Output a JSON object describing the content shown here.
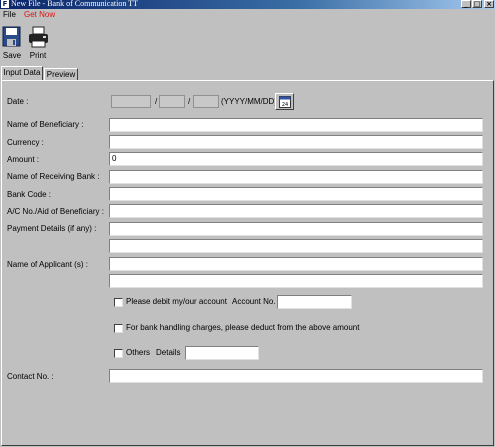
{
  "window": {
    "title": "New File - Bank of Communication TT"
  },
  "menu": {
    "file": "File",
    "get_now": "Get Now"
  },
  "toolbar": {
    "save_label": "Save",
    "print_label": "Print"
  },
  "tabs": [
    "Input Data",
    "Preview"
  ],
  "form": {
    "date_label": "Date :",
    "date_sep": "/",
    "date_format": "(YYYY/MM/DD)",
    "beneficiary_label": "Name of Beneficiary :",
    "currency_label": "Currency :",
    "amount_label": "Amount :",
    "amount_value": "0",
    "receiving_bank_label": "Name of Receiving Bank :",
    "bank_code_label": "Bank Code :",
    "account_label": "A/C No./Aid of Beneficiary :",
    "payment_details_label": "Payment Details (if any) :",
    "applicant_label": "Name of Applicant (s) :",
    "debit_text": "Please debit my/our account",
    "account_no_label": "Account No.",
    "charges_text": "For bank handling charges, please deduct from the above amount",
    "others_text": "Others",
    "details_label": "Details",
    "contact_label": "Contact No. :"
  },
  "icons": {
    "save": "floppy-disk-icon",
    "print": "printer-icon",
    "calendar": "calendar-icon"
  }
}
